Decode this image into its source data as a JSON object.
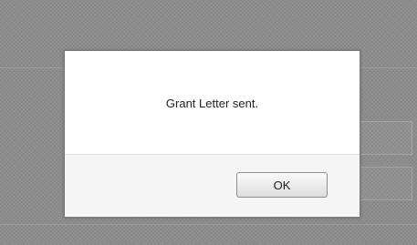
{
  "dialog": {
    "message": "Grant Letter sent.",
    "ok_label": "OK"
  }
}
